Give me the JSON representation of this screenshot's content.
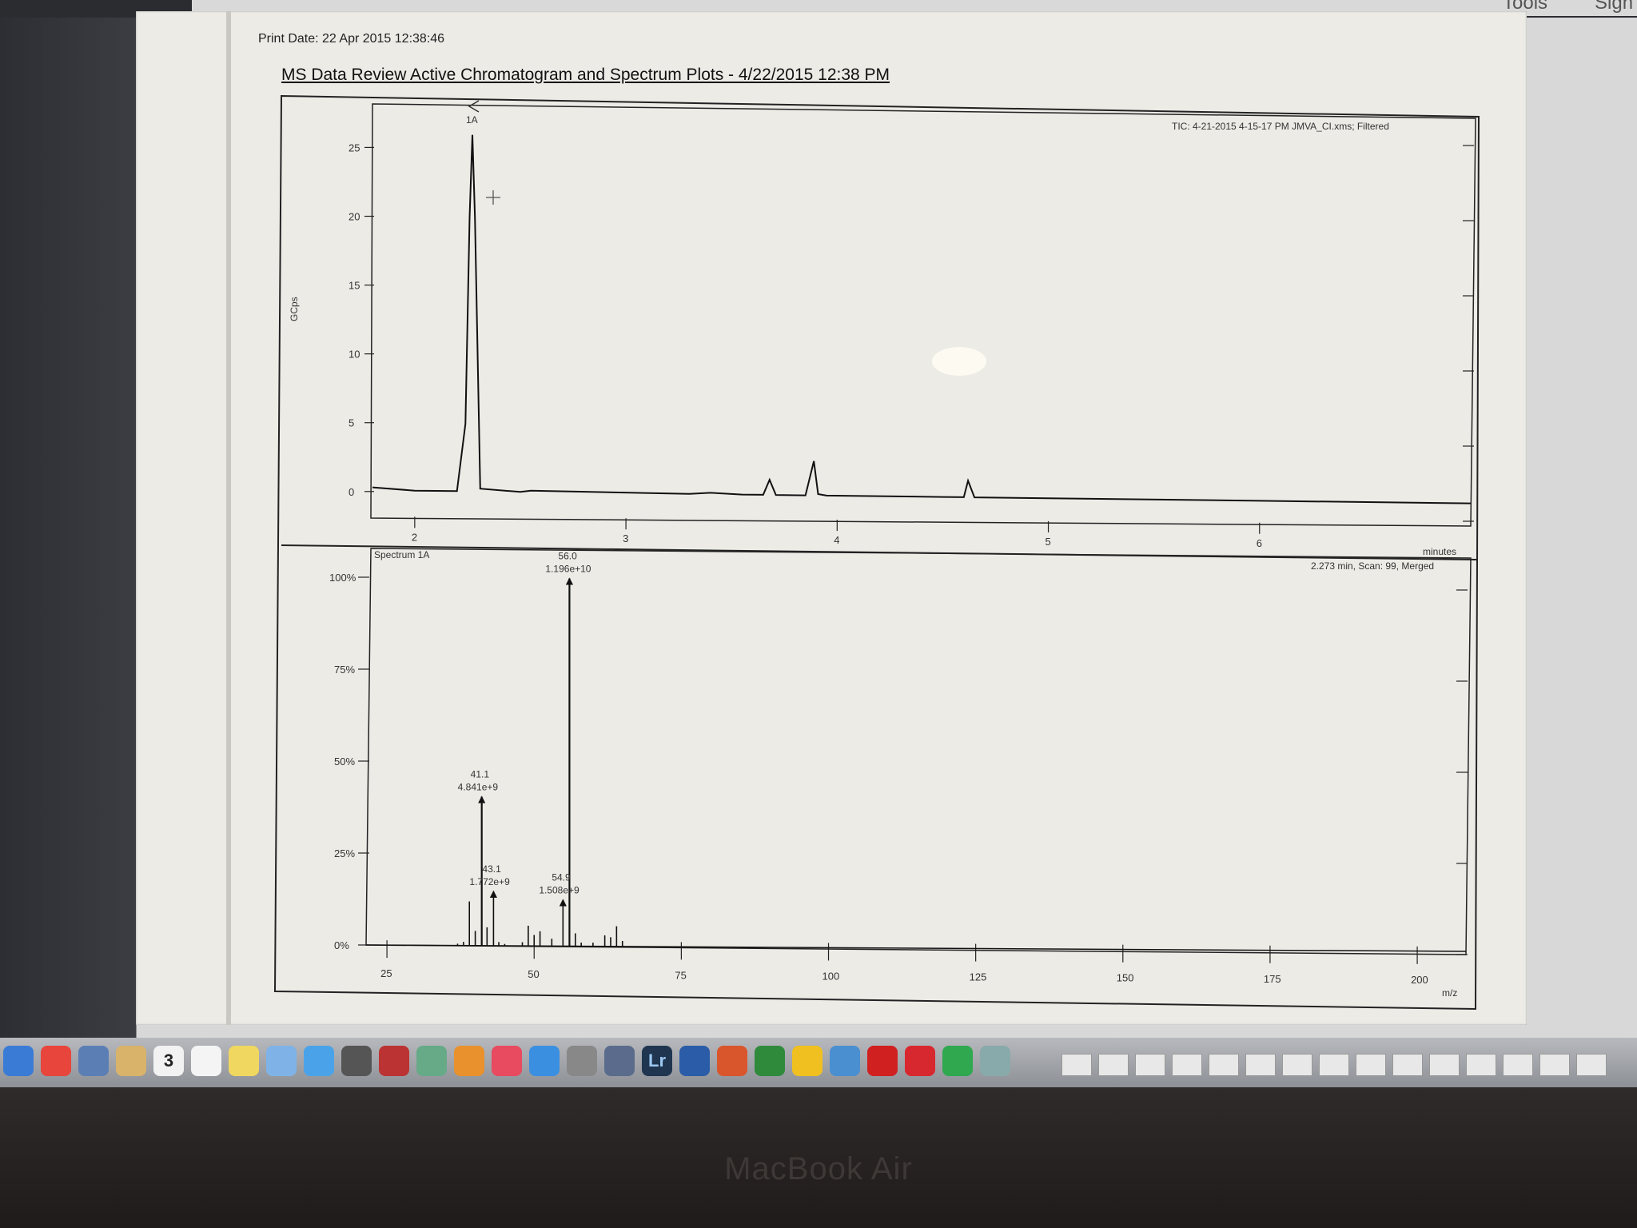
{
  "screen": {
    "device_label": "MacBook Air",
    "toolbar": {
      "tools_label": "Tools",
      "sign_label": "Sign"
    }
  },
  "page": {
    "print_date": "Print Date:  22 Apr 2015 12:38:46",
    "report_title": "MS Data Review Active Chromatogram and Spectrum Plots - 4/22/2015 12:38 PM"
  },
  "chart_data": [
    {
      "type": "line",
      "panel": "chromatogram",
      "title": "TIC: 4-21-2015 4-15-17 PM JMVA_CI.xms; Filtered",
      "ylabel": "GCps",
      "xlabel": "minutes",
      "xlim": [
        1.8,
        7.0
      ],
      "ylim": [
        -1,
        27
      ],
      "xticks": [
        "2",
        "3",
        "4",
        "5",
        "6"
      ],
      "yticks": [
        "0",
        "5",
        "10",
        "15",
        "20",
        "25"
      ],
      "peak_marker": "1A",
      "x": [
        1.8,
        2.0,
        2.2,
        2.24,
        2.26,
        2.273,
        2.285,
        2.31,
        2.5,
        2.55,
        3.3,
        3.4,
        3.55,
        3.65,
        3.68,
        3.71,
        3.85,
        3.89,
        3.91,
        3.95,
        4.5,
        4.6,
        4.62,
        4.65,
        5.0,
        6.0,
        7.0
      ],
      "y": [
        0.3,
        0.1,
        0.1,
        5.0,
        20.0,
        26.0,
        20.0,
        0.3,
        0.1,
        0.2,
        0.1,
        0.2,
        0.1,
        0.1,
        1.2,
        0.1,
        0.1,
        2.6,
        0.2,
        0.1,
        0.1,
        0.1,
        1.3,
        0.1,
        0.1,
        0.1,
        0.1
      ]
    },
    {
      "type": "bar",
      "panel": "spectrum",
      "title": "Spectrum 1A",
      "subtitle": "2.273 min, Scan: 99, Merged",
      "xlabel": "m/z",
      "ylabel": "",
      "xlim": [
        22,
        208
      ],
      "ylim": [
        0,
        100
      ],
      "xticks": [
        "25",
        "50",
        "75",
        "100",
        "125",
        "150",
        "175",
        "200"
      ],
      "yticks": [
        "0%",
        "25%",
        "50%",
        "75%",
        "100%"
      ],
      "x": [
        37,
        38,
        39,
        40,
        41.1,
        42,
        43.1,
        44,
        45,
        48,
        49,
        50,
        51,
        53,
        54.9,
        56.0,
        57,
        58,
        60,
        62,
        63,
        64,
        65
      ],
      "values": [
        0.5,
        1.0,
        12.0,
        4.0,
        40.5,
        5.0,
        14.8,
        1.0,
        0.5,
        1.0,
        5.5,
        3.0,
        4.0,
        2.0,
        12.6,
        100,
        3.5,
        1.0,
        1.0,
        3.0,
        2.5,
        5.5,
        1.5
      ],
      "annotations": [
        {
          "mz": "41.1",
          "intensity": "4.841e+9",
          "x": 41.1
        },
        {
          "mz": "43.1",
          "intensity": "1.772e+9",
          "x": 43.1
        },
        {
          "mz": "54.9",
          "intensity": "1.508e+9",
          "x": 54.9
        },
        {
          "mz": "56.0",
          "intensity": "1.196e+10",
          "x": 56.0
        }
      ]
    }
  ],
  "dock": {
    "icons": [
      "finder-icon",
      "chrome-icon",
      "preview-icon",
      "notes-icon",
      "calendar-icon",
      "textedit-icon",
      "stickies-icon",
      "photos-icon",
      "messages-icon",
      "facetime-icon",
      "photobooth-icon",
      "iphoto-icon",
      "ibooks-icon",
      "itunes-icon",
      "appstore-icon",
      "systemprefs-icon",
      "scriptedit-icon",
      "lightroom-icon",
      "word-icon",
      "powerpoint-icon",
      "excel-icon",
      "outlook-icon",
      "downloader-icon",
      "acrobat-icon",
      "creativecloud-icon",
      "evernote-icon",
      "utility-icon"
    ],
    "calendar_day": "3",
    "lightroom_label": "Lr"
  }
}
